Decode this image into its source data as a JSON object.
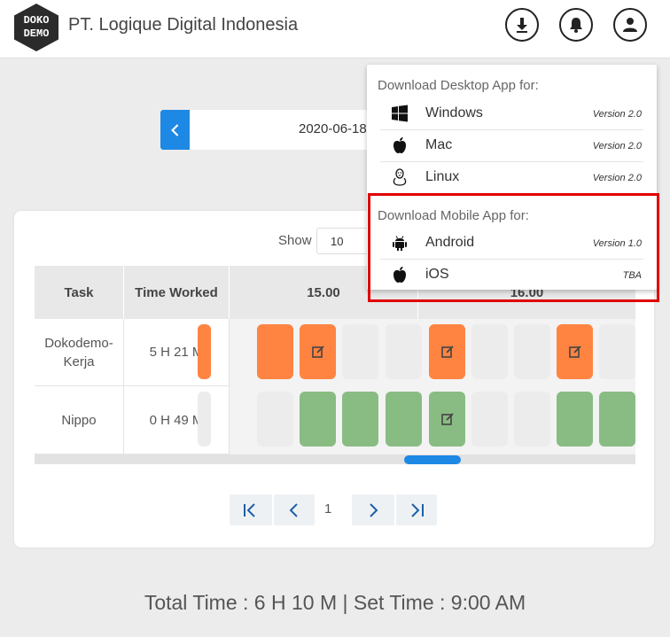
{
  "header": {
    "logo_top": "DOKO",
    "logo_bottom": "DEMO",
    "company": "PT. Logique Digital Indonesia"
  },
  "date_nav": {
    "date": "2020-06-18"
  },
  "table": {
    "show_label": "Show",
    "show_value": "10",
    "columns": {
      "task": "Task",
      "time_worked": "Time Worked",
      "hour1": "15.00",
      "hour2": "16.00"
    },
    "rows": [
      {
        "task": "Dokodemo-Kerja",
        "time": "5 H 21 M",
        "slots": [
          "orange",
          "orange",
          "orange-edit",
          "empty",
          "empty",
          "orange-edit",
          "empty",
          "empty",
          "orange-edit",
          "empty"
        ]
      },
      {
        "task": "Nippo",
        "time": "0 H 49 M",
        "slots": [
          "empty",
          "empty",
          "green",
          "green",
          "green",
          "green-edit",
          "empty",
          "empty",
          "green",
          "green"
        ]
      }
    ]
  },
  "pagination": {
    "current_page": "1"
  },
  "footer": {
    "summary": "Total Time : 6 H 10 M | Set Time : 9:00 AM"
  },
  "download_menu": {
    "desktop_heading": "Download Desktop App for:",
    "desktop": [
      {
        "name": "Windows",
        "version": "Version 2.0",
        "icon": "windows-icon"
      },
      {
        "name": "Mac",
        "version": "Version 2.0",
        "icon": "apple-icon"
      },
      {
        "name": "Linux",
        "version": "Version 2.0",
        "icon": "linux-icon"
      }
    ],
    "mobile_heading": "Download Mobile App for:",
    "mobile": [
      {
        "name": "Android",
        "version": "Version 1.0",
        "icon": "android-icon"
      },
      {
        "name": "iOS",
        "version": "TBA",
        "icon": "apple-icon"
      }
    ]
  },
  "colors": {
    "accent": "#1e88e5",
    "orange": "#ff8442",
    "green": "#89bc83",
    "highlight": "#e00000"
  }
}
